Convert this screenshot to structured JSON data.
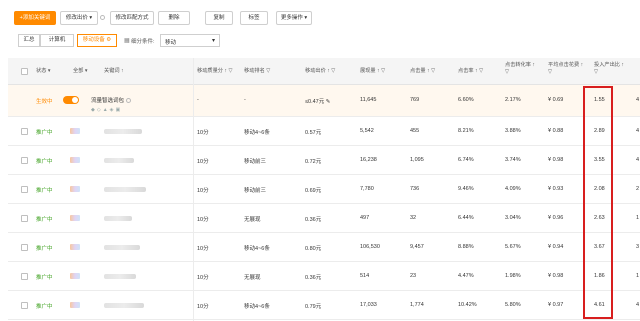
{
  "toolbar": {
    "add_keyword": "+添加关键词",
    "modify_bid": "修改出价",
    "modify_match": "修改匹配方式",
    "delete": "删除",
    "copy": "复制",
    "tag": "标签",
    "more": "更多操作"
  },
  "filter": {
    "tab_all": "汇总",
    "tab_pc": "计算机",
    "tab_mobile": "移动设备",
    "breakdown_label": "细分条件:",
    "breakdown_value": "移动"
  },
  "columns": {
    "status": "状态",
    "all": "全部",
    "keyword": "关键词 ↑",
    "quality": "移动质量分 ↑",
    "rank": "移动排名",
    "bid": "移动出价 ↑",
    "impressions": "展现量 ↑",
    "clicks": "点击量 ↑",
    "ctr": "点击率 ↑",
    "cvr": "点击转化率 ↑",
    "avg_cost": "平均点击花费 ↑",
    "roi": "投入产出比 ↑",
    "filter_icon": "▽"
  },
  "first_row": {
    "status": "生效中",
    "keyword": "流量智选词包",
    "quality": "-",
    "rank": "-",
    "bid": "≤0.47元",
    "impressions": "11,645",
    "clicks": "769",
    "ctr": "6.60%",
    "cvr": "2.17%",
    "avg_cost": "¥ 0.69",
    "roi": "1.55",
    "extra": "4"
  },
  "rows": [
    {
      "status": "推广中",
      "quality": "10分",
      "rank": "移动4~6条",
      "bid": "0.57元",
      "impressions": "5,542",
      "clicks": "455",
      "ctr": "8.21%",
      "cvr": "3.88%",
      "avg_cost": "¥ 0.88",
      "roi": "2.89",
      "extra": "4"
    },
    {
      "status": "推广中",
      "quality": "10分",
      "rank": "移动前三",
      "bid": "0.72元",
      "impressions": "16,238",
      "clicks": "1,095",
      "ctr": "6.74%",
      "cvr": "3.74%",
      "avg_cost": "¥ 0.98",
      "roi": "3.55",
      "extra": "4"
    },
    {
      "status": "推广中",
      "quality": "10分",
      "rank": "移动前三",
      "bid": "0.69元",
      "impressions": "7,780",
      "clicks": "736",
      "ctr": "9.46%",
      "cvr": "4.09%",
      "avg_cost": "¥ 0.93",
      "roi": "2.08",
      "extra": "2"
    },
    {
      "status": "推广中",
      "quality": "10分",
      "rank": "无展现",
      "bid": "0.36元",
      "impressions": "497",
      "clicks": "32",
      "ctr": "6.44%",
      "cvr": "3.04%",
      "avg_cost": "¥ 0.96",
      "roi": "2.63",
      "extra": "1"
    },
    {
      "status": "推广中",
      "quality": "10分",
      "rank": "移动4~6条",
      "bid": "0.80元",
      "impressions": "106,530",
      "clicks": "9,457",
      "ctr": "8.88%",
      "cvr": "5.67%",
      "avg_cost": "¥ 0.94",
      "roi": "3.67",
      "extra": "3"
    },
    {
      "status": "推广中",
      "quality": "10分",
      "rank": "无展现",
      "bid": "0.36元",
      "impressions": "514",
      "clicks": "23",
      "ctr": "4.47%",
      "cvr": "1.98%",
      "avg_cost": "¥ 0.98",
      "roi": "1.86",
      "extra": "1"
    },
    {
      "status": "推广中",
      "quality": "10分",
      "rank": "移动4~6条",
      "bid": "0.79元",
      "impressions": "17,033",
      "clicks": "1,774",
      "ctr": "10.42%",
      "cvr": "5.80%",
      "avg_cost": "¥ 0.97",
      "roi": "4.61",
      "extra": "4"
    }
  ],
  "colors": {
    "accent": "#ff8a00",
    "status_green": "#42a324",
    "highlight_box": "#d81e1e"
  }
}
